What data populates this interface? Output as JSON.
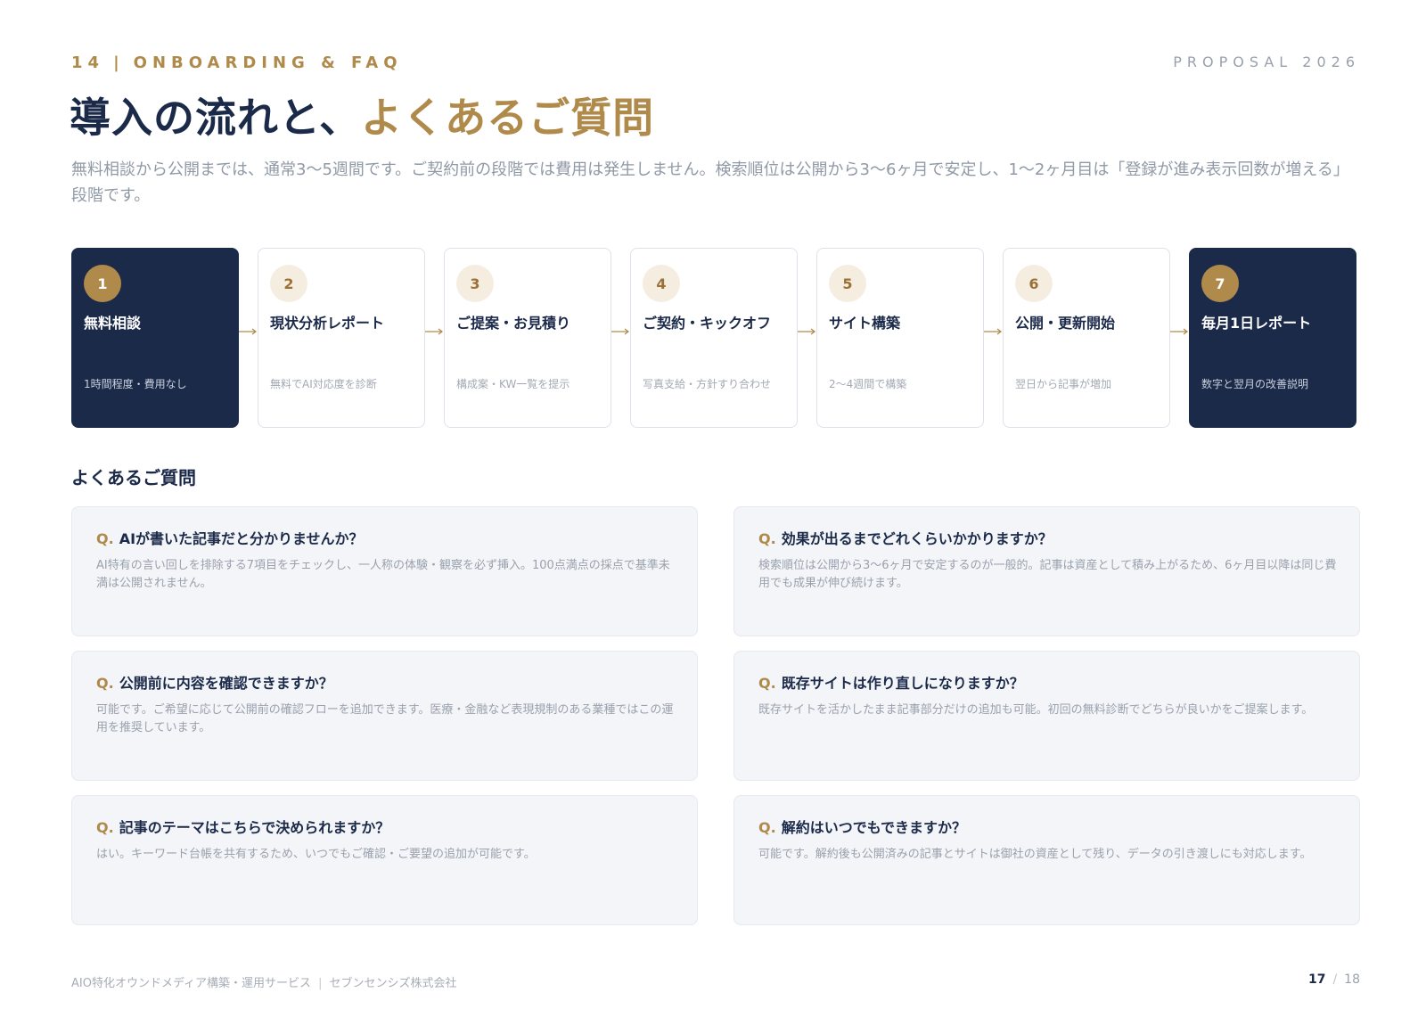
{
  "header": {
    "page_no": "14",
    "divider": "|",
    "section": "ONBOARDING & FAQ",
    "proposal": "PROPOSAL 2026"
  },
  "title": {
    "main": "導入の流れと、",
    "accent": "よくあるご質問"
  },
  "lead": "無料相談から公開までは、通常3〜5週間です。ご契約前の段階では費用は発生しません。検索順位は公開から3〜6ヶ月で安定し、1〜2ヶ月目は「登録が進み表示回数が増える」段階です。",
  "steps": [
    {
      "num": "1",
      "title": "無料相談",
      "desc": "1時間程度・費用なし"
    },
    {
      "num": "2",
      "title": "現状分析レポート",
      "desc": "無料でAI対応度を診断"
    },
    {
      "num": "3",
      "title": "ご提案・お見積り",
      "desc": "構成案・KW一覧を提示"
    },
    {
      "num": "4",
      "title": "ご契約・キックオフ",
      "desc": "写真支給・方針すり合わせ"
    },
    {
      "num": "5",
      "title": "サイト構築",
      "desc": "2〜4週間で構築"
    },
    {
      "num": "6",
      "title": "公開・更新開始",
      "desc": "翌日から記事が増加"
    },
    {
      "num": "7",
      "title": "毎月1日レポート",
      "desc": "数字と翌月の改善説明"
    }
  ],
  "faq_heading": "よくあるご質問",
  "faq": [
    {
      "q_prefix": "Q.",
      "q": "AIが書いた記事だと分かりませんか？",
      "a": "AI特有の言い回しを排除する7項目をチェックし、一人称の体験・観察を必ず挿入。100点満点の採点で基準未満は公開されません。"
    },
    {
      "q_prefix": "Q.",
      "q": "効果が出るまでどれくらいかかりますか？",
      "a": "検索順位は公開から3〜6ヶ月で安定するのが一般的。記事は資産として積み上がるため、6ヶ月目以降は同じ費用でも成果が伸び続けます。"
    },
    {
      "q_prefix": "Q.",
      "q": "公開前に内容を確認できますか？",
      "a": "可能です。ご希望に応じて公開前の確認フローを追加できます。医療・金融など表現規制のある業種ではこの運用を推奨しています。"
    },
    {
      "q_prefix": "Q.",
      "q": "既存サイトは作り直しになりますか？",
      "a": "既存サイトを活かしたまま記事部分だけの追加も可能。初回の無料診断でどちらが良いかをご提案します。"
    },
    {
      "q_prefix": "Q.",
      "q": "記事のテーマはこちらで決められますか？",
      "a": "はい。キーワード台帳を共有するため、いつでもご確認・ご要望の追加が可能です。"
    },
    {
      "q_prefix": "Q.",
      "q": "解約はいつでもできますか？",
      "a": "可能です。解約後も公開済みの記事とサイトは御社の資産として残り、データの引き渡しにも対応します。"
    }
  ],
  "footer": {
    "service": "AIO特化オウンドメディア構築・運用サービス",
    "divider": "|",
    "company": "セブンセンシズ株式会社",
    "page_current": "17",
    "page_sep": "/",
    "page_total": "18"
  },
  "colors": {
    "navy": "#1c2a4a",
    "gold": "#b08a4a",
    "muted": "#9aa1ad",
    "card_bg": "#f3f5f8"
  }
}
